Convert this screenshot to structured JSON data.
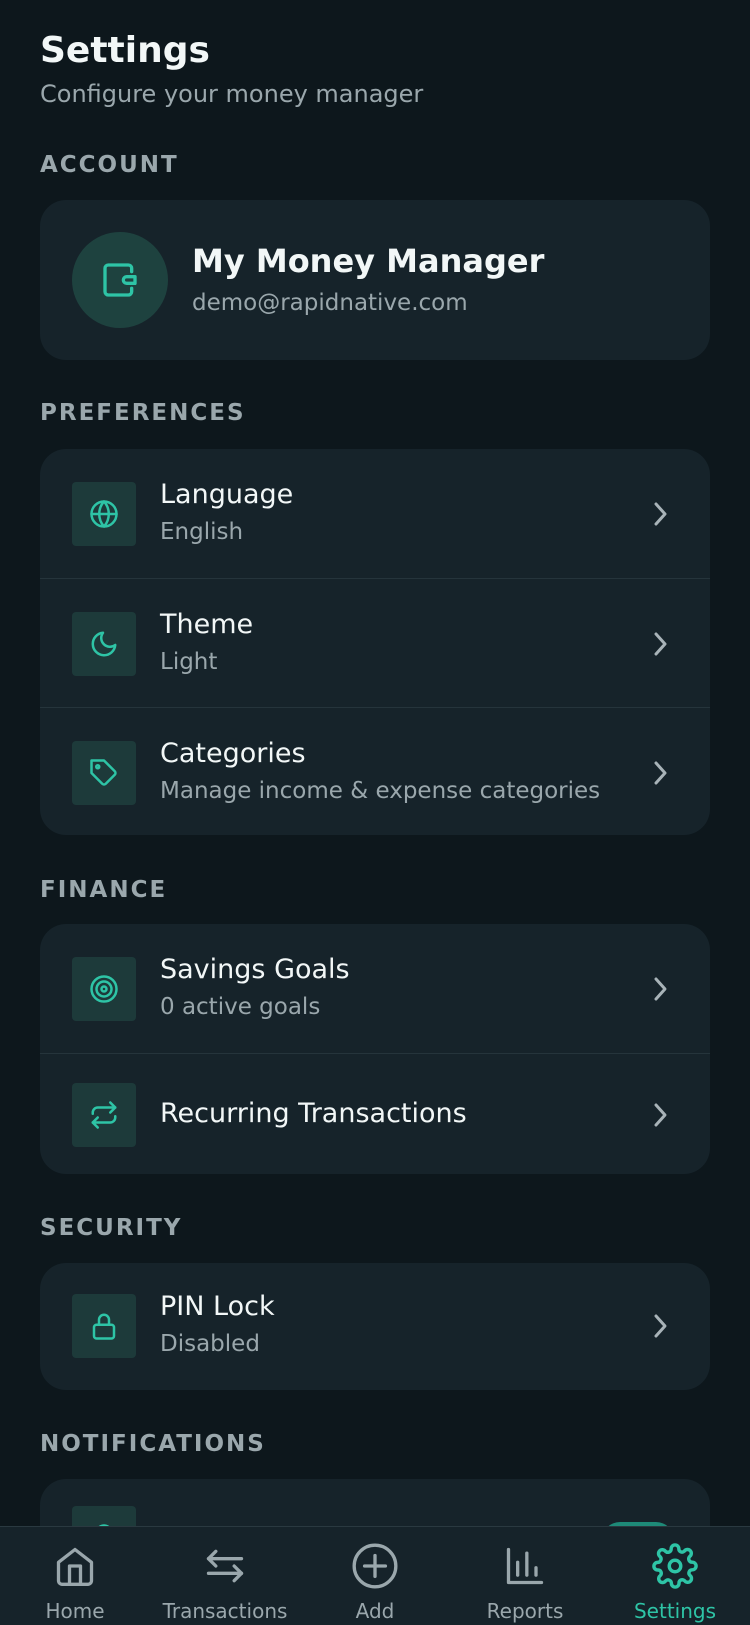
{
  "header": {
    "title": "Settings",
    "subtitle": "Configure your money manager"
  },
  "sections": {
    "account": "ACCOUNT",
    "preferences": "PREFERENCES",
    "finance": "FINANCE",
    "security": "SECURITY",
    "notifications": "NOTIFICATIONS"
  },
  "account": {
    "name": "My Money Manager",
    "email": "demo@rapidnative.com",
    "icon": "wallet-icon"
  },
  "preferences": {
    "language": {
      "title": "Language",
      "value": "English",
      "icon": "globe-icon"
    },
    "theme": {
      "title": "Theme",
      "value": "Light",
      "icon": "moon-icon"
    },
    "categories": {
      "title": "Categories",
      "value": "Manage income & expense categories",
      "icon": "tag-icon"
    }
  },
  "finance": {
    "savings_goals": {
      "title": "Savings Goals",
      "value": "0 active goals",
      "icon": "target-icon"
    },
    "recurring": {
      "title": "Recurring Transactions",
      "icon": "repeat-icon"
    }
  },
  "security": {
    "pin_lock": {
      "title": "PIN Lock",
      "value": "Disabled",
      "icon": "lock-icon"
    }
  },
  "notifications": {
    "toggle_on": true
  },
  "tabbar": {
    "home": "Home",
    "transactions": "Transactions",
    "add": "Add",
    "reports": "Reports",
    "settings": "Settings",
    "active": "settings"
  },
  "colors": {
    "background": "#0d171c",
    "card": "#16232a",
    "accent": "#2ec4a6",
    "muted_text": "#9aa7ac"
  }
}
